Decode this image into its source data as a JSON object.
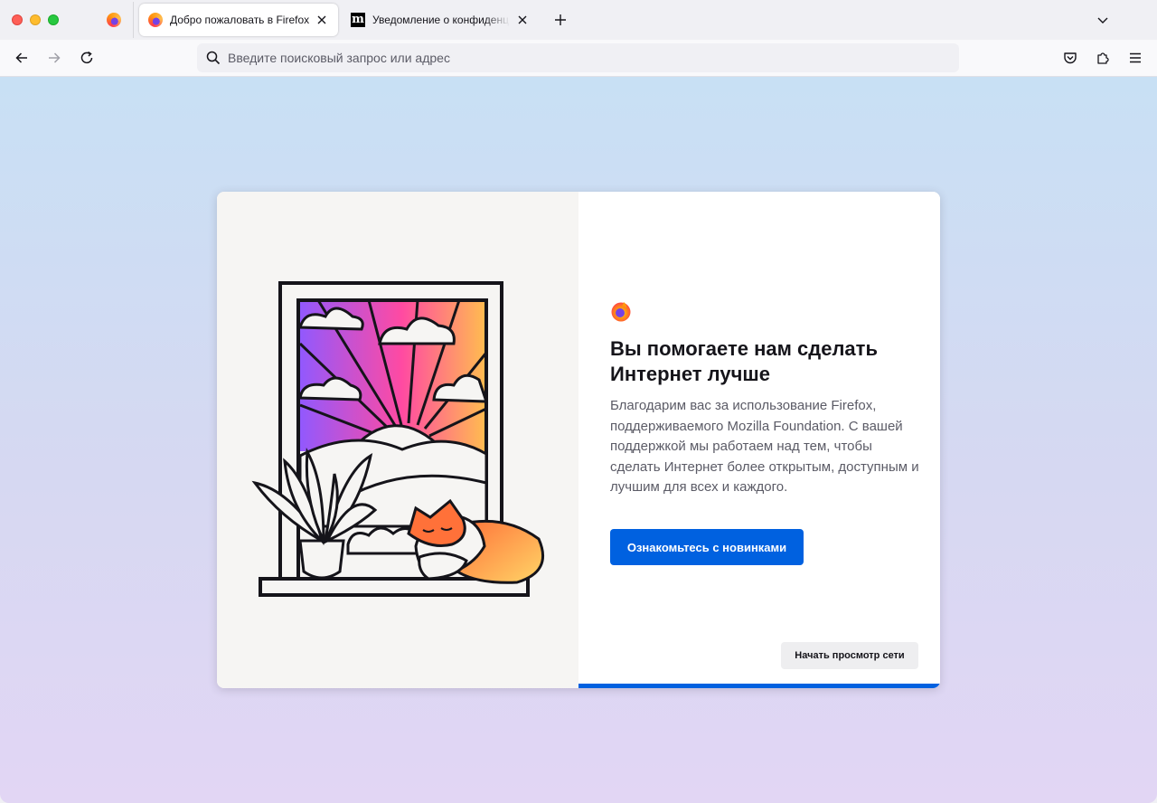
{
  "tabs": [
    {
      "label": "Добро пожаловать в Firefox",
      "icon": "firefox-logo-icon",
      "active": true
    },
    {
      "label": "Уведомление о конфиденциальности",
      "icon": "mozilla-m-icon",
      "active": false
    }
  ],
  "pinned_tab": {
    "icon": "firefox-logo-icon"
  },
  "urlbar": {
    "placeholder": "Введите поисковый запрос или адрес"
  },
  "welcome": {
    "title": "Вы помогаете нам сделать Интернет лучше",
    "body": "Благодарим вас за использование Firefox, поддерживаемого Mozilla Foundation. С вашей поддержкой мы работаем над тем, чтобы сделать Интернет более открытым, доступным и лучшим для всех и каждого.",
    "primary_button": "Ознакомьтесь с новинками",
    "secondary_button": "Начать просмотр сети"
  },
  "colors": {
    "accent": "#0061e0",
    "traffic_red": "#fe5f57",
    "traffic_yellow": "#febc2e",
    "traffic_green": "#28c840"
  }
}
